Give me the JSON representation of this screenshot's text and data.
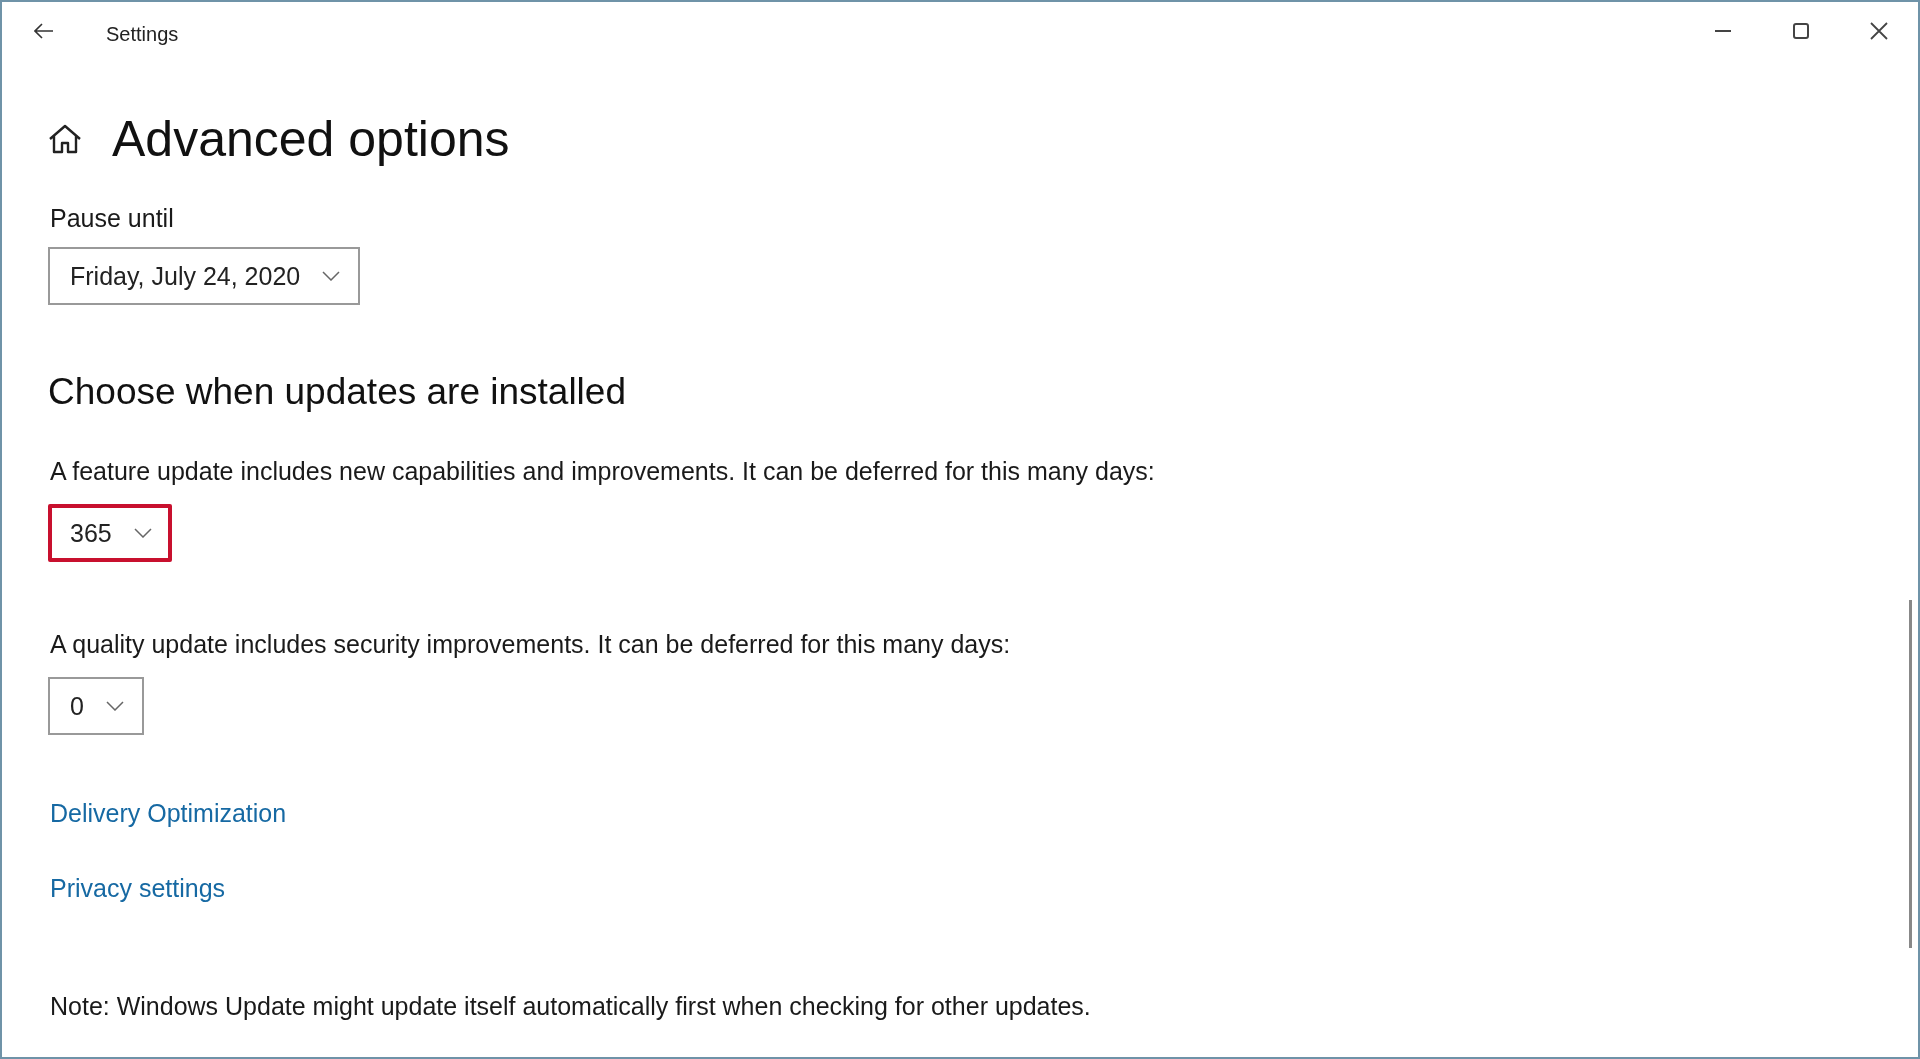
{
  "window": {
    "title": "Settings"
  },
  "page": {
    "title": "Advanced options"
  },
  "pause": {
    "label": "Pause until",
    "dropdown": {
      "value": "Friday, July 24, 2020",
      "highlighted": false
    }
  },
  "section": {
    "heading": "Choose when updates are installed",
    "deferrals": [
      {
        "description": "A feature update includes new capabilities and improvements. It can be deferred for this many days:",
        "dropdown": {
          "value": "365",
          "highlighted": true
        }
      },
      {
        "description": "A quality update includes security improvements. It can be deferred for this many days:",
        "dropdown": {
          "value": "0",
          "highlighted": false
        }
      }
    ]
  },
  "links": [
    "Delivery Optimization",
    "Privacy settings"
  ],
  "note": "Note: Windows Update might update itself automatically first when checking for other updates."
}
